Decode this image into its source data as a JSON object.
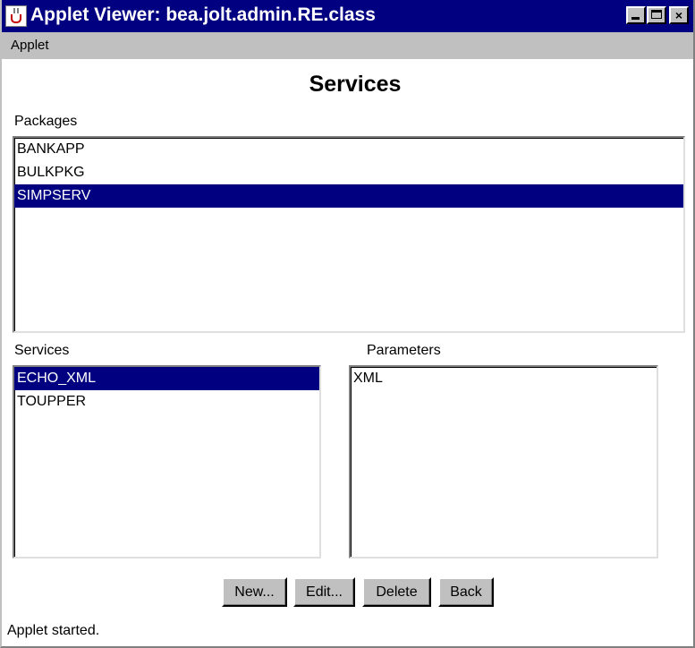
{
  "window": {
    "title": "Applet Viewer: bea.jolt.admin.RE.class",
    "icon": "java-cup-icon",
    "controls": {
      "minimize": "minimize-icon",
      "maximize": "maximize-icon",
      "close": "×"
    }
  },
  "menubar": {
    "items": [
      {
        "label": "Applet"
      }
    ]
  },
  "page": {
    "heading": "Services"
  },
  "packages": {
    "label": "Packages",
    "items": [
      "BANKAPP",
      "BULKPKG",
      "SIMPSERV"
    ],
    "selected": "SIMPSERV"
  },
  "services": {
    "label": "Services",
    "items": [
      "ECHO_XML",
      "TOUPPER"
    ],
    "selected": "ECHO_XML"
  },
  "parameters": {
    "label": "Parameters",
    "items": [
      "XML"
    ]
  },
  "buttons": {
    "new_label": "New...",
    "edit_label": "Edit...",
    "delete_label": "Delete",
    "back_label": "Back"
  },
  "status": {
    "text": "Applet started."
  },
  "colors": {
    "title_bar": "#000080",
    "selection": "#000080",
    "chrome": "#c0c0c0"
  }
}
